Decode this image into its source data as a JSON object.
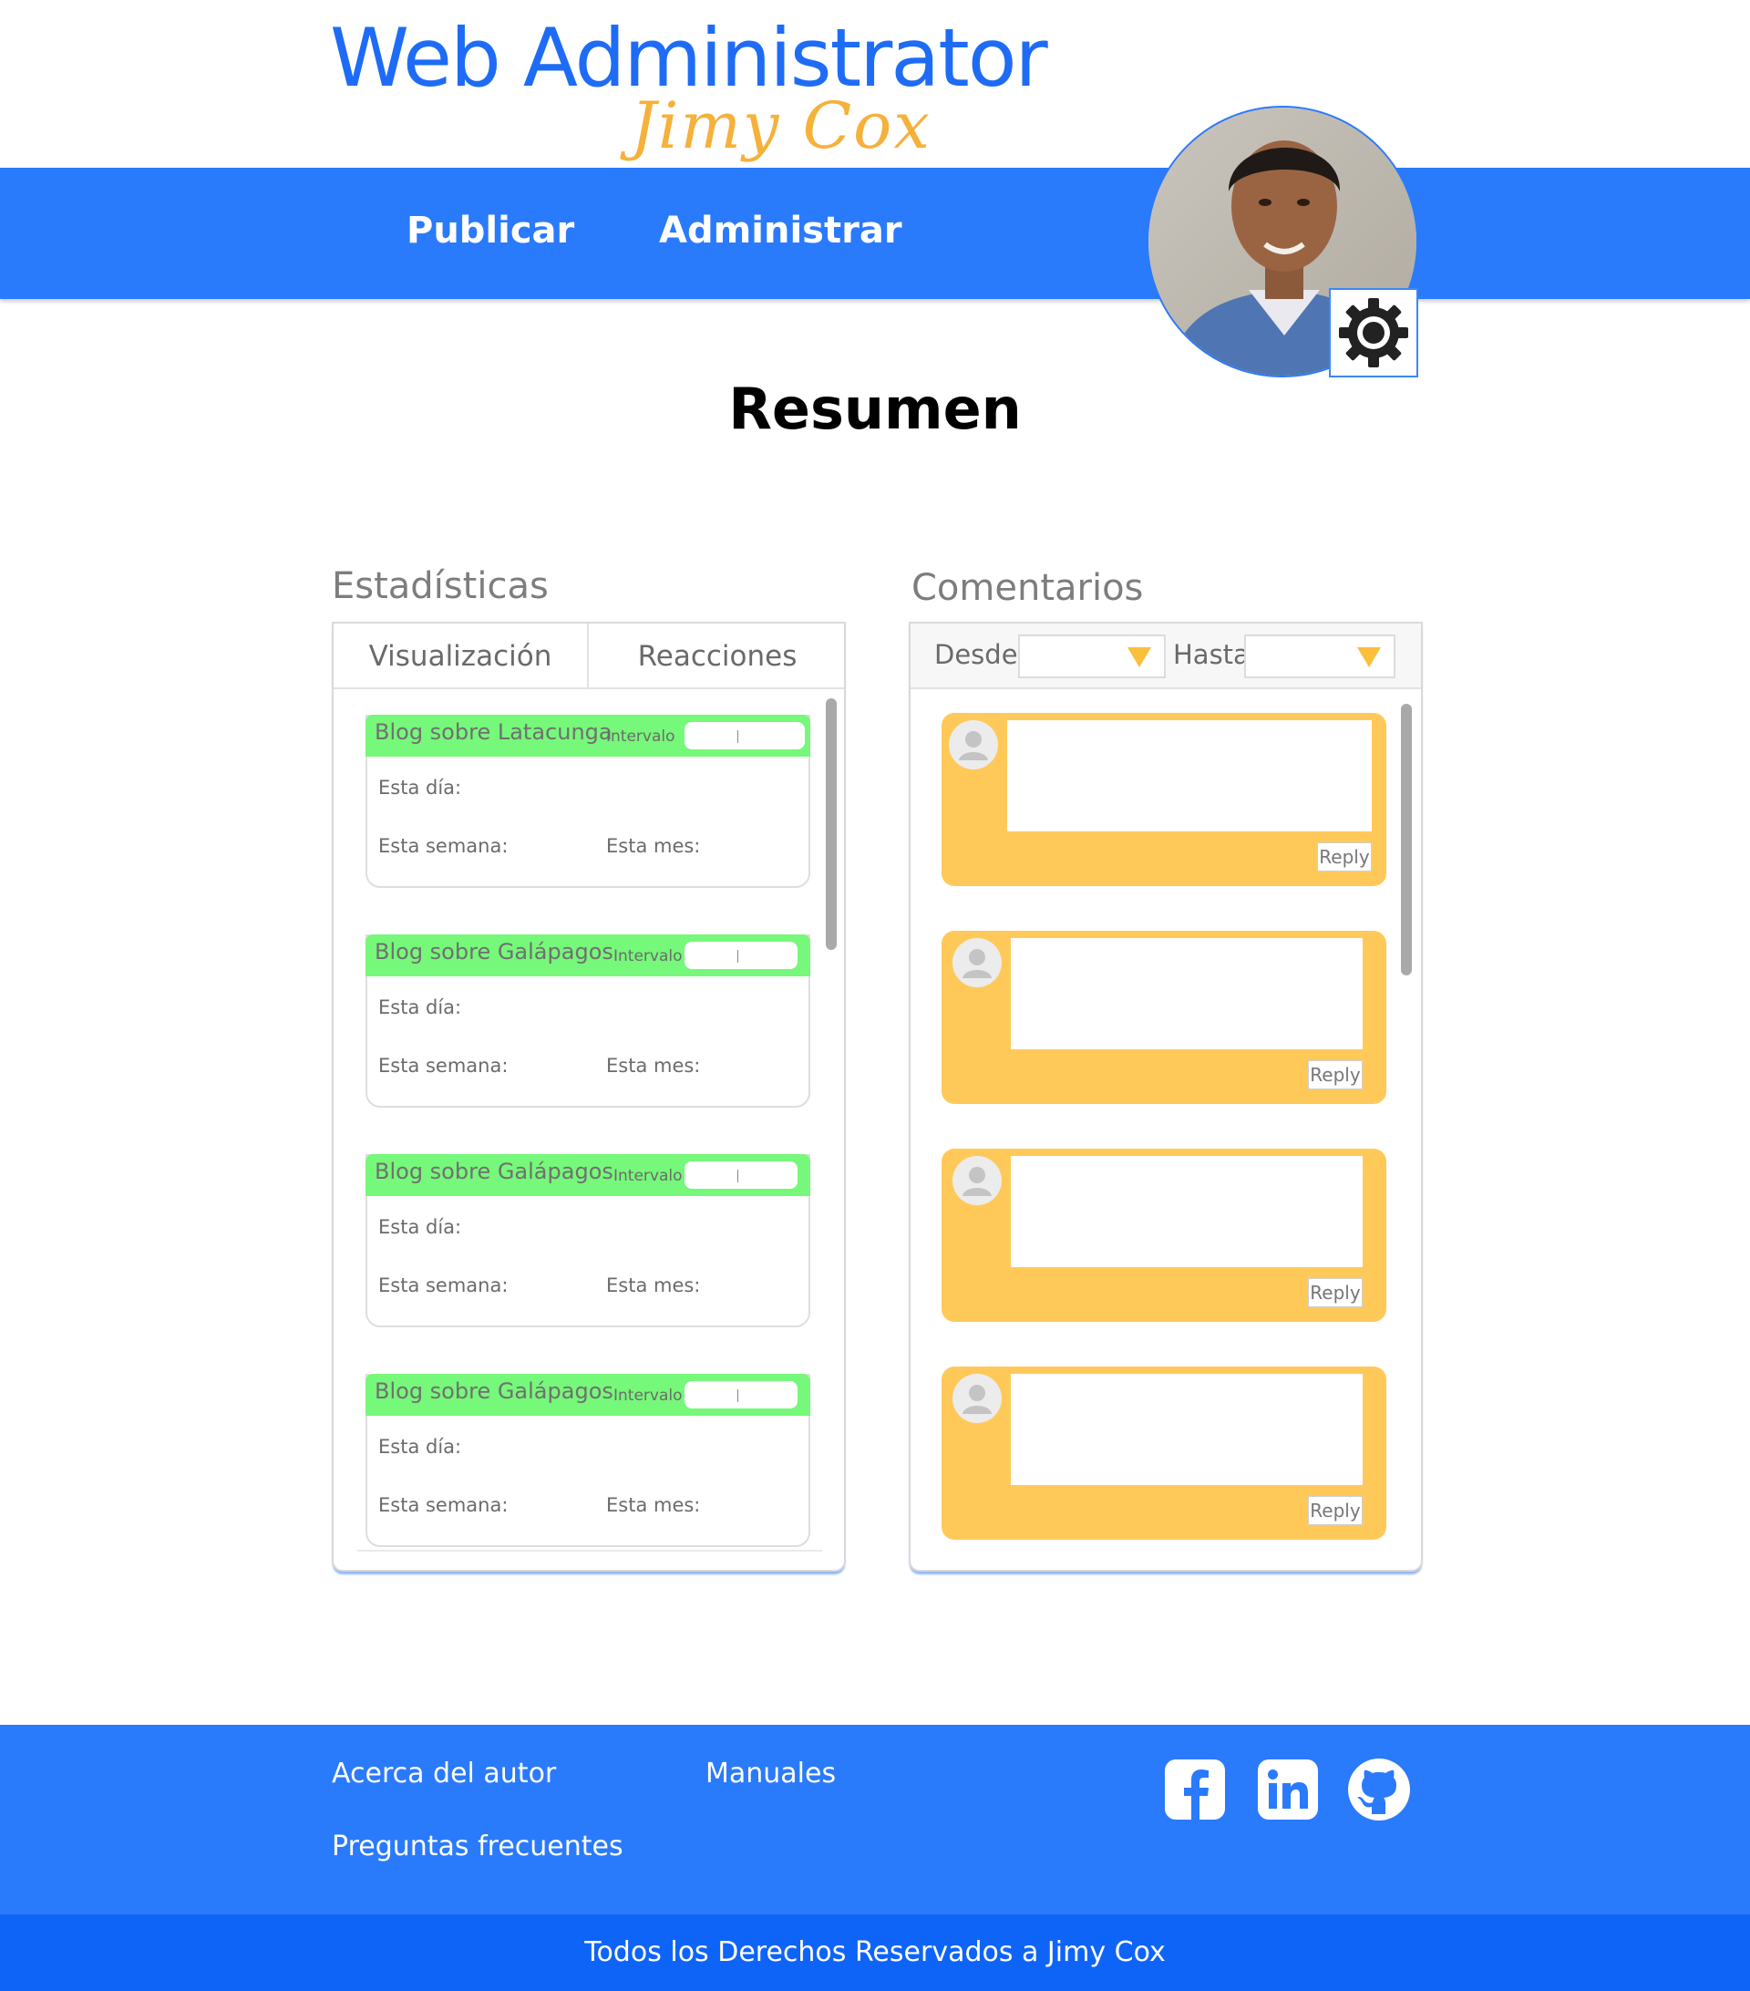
{
  "logo": {
    "title": "Web Administrator",
    "subtitle": "Jimy Cox"
  },
  "nav": {
    "items": [
      {
        "label": "Publicar"
      },
      {
        "label": "Administrar"
      }
    ]
  },
  "user": {
    "avatar_icon": "user-photo",
    "settings_icon": "gear-icon"
  },
  "page": {
    "title": "Resumen"
  },
  "stats": {
    "heading": "Estadísticas",
    "tabs": [
      {
        "label": "Visualización"
      },
      {
        "label": "Reacciones"
      }
    ],
    "cards": [
      {
        "title": "Blog sobre Latacunga",
        "interval_label": "Intervalo",
        "day_label": "Esta día:",
        "week_label": "Esta semana:",
        "month_label": "Esta mes:"
      },
      {
        "title": "Blog sobre Galápagos",
        "interval_label": "Intervalo",
        "day_label": "Esta día:",
        "week_label": "Esta semana:",
        "month_label": "Esta mes:"
      },
      {
        "title": "Blog sobre Galápagos",
        "interval_label": "Intervalo",
        "day_label": "Esta día:",
        "week_label": "Esta semana:",
        "month_label": "Esta mes:"
      },
      {
        "title": "Blog sobre Galápagos",
        "interval_label": "Intervalo",
        "day_label": "Esta día:",
        "week_label": "Esta semana:",
        "month_label": "Esta mes:"
      }
    ]
  },
  "comments": {
    "heading": "Comentarios",
    "filter": {
      "from_label": "Desde",
      "to_label": "Hasta",
      "from_value": "",
      "to_value": ""
    },
    "items": [
      {
        "text": "",
        "reply_label": "Reply"
      },
      {
        "text": "",
        "reply_label": "Reply"
      },
      {
        "text": "",
        "reply_label": "Reply"
      },
      {
        "text": "",
        "reply_label": "Reply"
      }
    ]
  },
  "footer": {
    "links": [
      {
        "label": "Acerca del autor"
      },
      {
        "label": "Manuales"
      },
      {
        "label": "Preguntas frecuentes"
      }
    ],
    "social_icons": [
      "facebook-icon",
      "linkedin-icon",
      "github-icon"
    ],
    "copyright": "Todos los Derechos Reservados a Jimy Cox"
  },
  "colors": {
    "primary": "#2a7afc",
    "primary_dark": "#0f64f8",
    "accent": "#ffc95a",
    "stat_header": "#76f87a",
    "logo_blue": "#1e6cf5",
    "logo_orange": "#f5b13a"
  }
}
